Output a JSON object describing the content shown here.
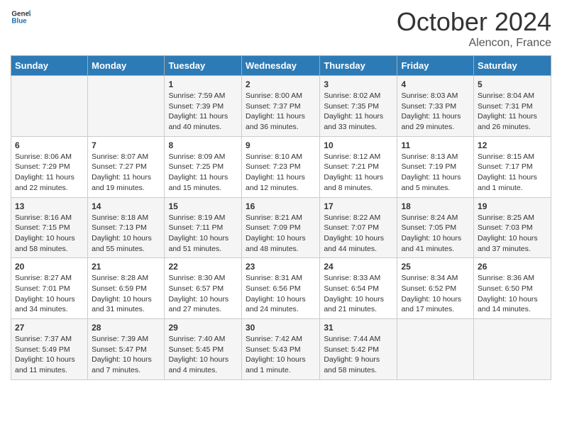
{
  "header": {
    "logo_general": "General",
    "logo_blue": "Blue",
    "month_title": "October 2024",
    "location": "Alencon, France"
  },
  "days_of_week": [
    "Sunday",
    "Monday",
    "Tuesday",
    "Wednesday",
    "Thursday",
    "Friday",
    "Saturday"
  ],
  "weeks": [
    [
      {
        "day": "",
        "content": ""
      },
      {
        "day": "",
        "content": ""
      },
      {
        "day": "1",
        "content": "Sunrise: 7:59 AM\nSunset: 7:39 PM\nDaylight: 11 hours and 40 minutes."
      },
      {
        "day": "2",
        "content": "Sunrise: 8:00 AM\nSunset: 7:37 PM\nDaylight: 11 hours and 36 minutes."
      },
      {
        "day": "3",
        "content": "Sunrise: 8:02 AM\nSunset: 7:35 PM\nDaylight: 11 hours and 33 minutes."
      },
      {
        "day": "4",
        "content": "Sunrise: 8:03 AM\nSunset: 7:33 PM\nDaylight: 11 hours and 29 minutes."
      },
      {
        "day": "5",
        "content": "Sunrise: 8:04 AM\nSunset: 7:31 PM\nDaylight: 11 hours and 26 minutes."
      }
    ],
    [
      {
        "day": "6",
        "content": "Sunrise: 8:06 AM\nSunset: 7:29 PM\nDaylight: 11 hours and 22 minutes."
      },
      {
        "day": "7",
        "content": "Sunrise: 8:07 AM\nSunset: 7:27 PM\nDaylight: 11 hours and 19 minutes."
      },
      {
        "day": "8",
        "content": "Sunrise: 8:09 AM\nSunset: 7:25 PM\nDaylight: 11 hours and 15 minutes."
      },
      {
        "day": "9",
        "content": "Sunrise: 8:10 AM\nSunset: 7:23 PM\nDaylight: 11 hours and 12 minutes."
      },
      {
        "day": "10",
        "content": "Sunrise: 8:12 AM\nSunset: 7:21 PM\nDaylight: 11 hours and 8 minutes."
      },
      {
        "day": "11",
        "content": "Sunrise: 8:13 AM\nSunset: 7:19 PM\nDaylight: 11 hours and 5 minutes."
      },
      {
        "day": "12",
        "content": "Sunrise: 8:15 AM\nSunset: 7:17 PM\nDaylight: 11 hours and 1 minute."
      }
    ],
    [
      {
        "day": "13",
        "content": "Sunrise: 8:16 AM\nSunset: 7:15 PM\nDaylight: 10 hours and 58 minutes."
      },
      {
        "day": "14",
        "content": "Sunrise: 8:18 AM\nSunset: 7:13 PM\nDaylight: 10 hours and 55 minutes."
      },
      {
        "day": "15",
        "content": "Sunrise: 8:19 AM\nSunset: 7:11 PM\nDaylight: 10 hours and 51 minutes."
      },
      {
        "day": "16",
        "content": "Sunrise: 8:21 AM\nSunset: 7:09 PM\nDaylight: 10 hours and 48 minutes."
      },
      {
        "day": "17",
        "content": "Sunrise: 8:22 AM\nSunset: 7:07 PM\nDaylight: 10 hours and 44 minutes."
      },
      {
        "day": "18",
        "content": "Sunrise: 8:24 AM\nSunset: 7:05 PM\nDaylight: 10 hours and 41 minutes."
      },
      {
        "day": "19",
        "content": "Sunrise: 8:25 AM\nSunset: 7:03 PM\nDaylight: 10 hours and 37 minutes."
      }
    ],
    [
      {
        "day": "20",
        "content": "Sunrise: 8:27 AM\nSunset: 7:01 PM\nDaylight: 10 hours and 34 minutes."
      },
      {
        "day": "21",
        "content": "Sunrise: 8:28 AM\nSunset: 6:59 PM\nDaylight: 10 hours and 31 minutes."
      },
      {
        "day": "22",
        "content": "Sunrise: 8:30 AM\nSunset: 6:57 PM\nDaylight: 10 hours and 27 minutes."
      },
      {
        "day": "23",
        "content": "Sunrise: 8:31 AM\nSunset: 6:56 PM\nDaylight: 10 hours and 24 minutes."
      },
      {
        "day": "24",
        "content": "Sunrise: 8:33 AM\nSunset: 6:54 PM\nDaylight: 10 hours and 21 minutes."
      },
      {
        "day": "25",
        "content": "Sunrise: 8:34 AM\nSunset: 6:52 PM\nDaylight: 10 hours and 17 minutes."
      },
      {
        "day": "26",
        "content": "Sunrise: 8:36 AM\nSunset: 6:50 PM\nDaylight: 10 hours and 14 minutes."
      }
    ],
    [
      {
        "day": "27",
        "content": "Sunrise: 7:37 AM\nSunset: 5:49 PM\nDaylight: 10 hours and 11 minutes."
      },
      {
        "day": "28",
        "content": "Sunrise: 7:39 AM\nSunset: 5:47 PM\nDaylight: 10 hours and 7 minutes."
      },
      {
        "day": "29",
        "content": "Sunrise: 7:40 AM\nSunset: 5:45 PM\nDaylight: 10 hours and 4 minutes."
      },
      {
        "day": "30",
        "content": "Sunrise: 7:42 AM\nSunset: 5:43 PM\nDaylight: 10 hours and 1 minute."
      },
      {
        "day": "31",
        "content": "Sunrise: 7:44 AM\nSunset: 5:42 PM\nDaylight: 9 hours and 58 minutes."
      },
      {
        "day": "",
        "content": ""
      },
      {
        "day": "",
        "content": ""
      }
    ]
  ]
}
